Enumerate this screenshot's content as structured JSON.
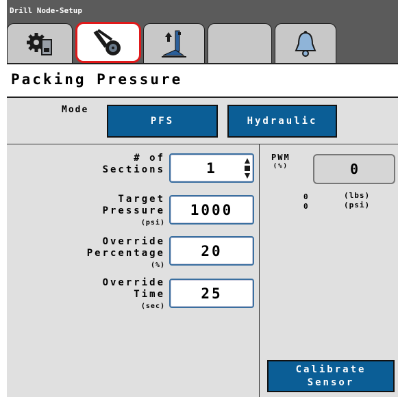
{
  "window": {
    "title": "Drill Node-Setup"
  },
  "tabs": [
    {
      "name": "settings-gear-tab",
      "icon": "gear-icon"
    },
    {
      "name": "packing-wheel-tab",
      "icon": "packing-wheel-icon",
      "active": true
    },
    {
      "name": "lift-tab",
      "icon": "lift-arrow-icon"
    },
    {
      "name": "empty-tab",
      "icon": ""
    },
    {
      "name": "alarm-tab",
      "icon": "bell-icon"
    }
  ],
  "page": {
    "title": "Packing Pressure"
  },
  "mode": {
    "label": "Mode",
    "options": [
      "PFS",
      "Hydraulic"
    ]
  },
  "fields": {
    "sections": {
      "label_line1": "# of",
      "label_line2": "Sections",
      "value": "1"
    },
    "target_pressure": {
      "label_line1": "Target",
      "label_line2": "Pressure",
      "unit": "(psi)",
      "value": "1000"
    },
    "override_percentage": {
      "label_line1": "Override",
      "label_line2": "Percentage",
      "unit": "(%)",
      "value": "20"
    },
    "override_time": {
      "label_line1": "Override",
      "label_line2": "Time",
      "unit": "(sec)",
      "value": "25"
    }
  },
  "readout": {
    "pwm_label": "PWM",
    "pwm_unit": "(%)",
    "pwm_value": "0",
    "lbs_value": "0",
    "lbs_unit": "(lbs)",
    "psi_value": "0",
    "psi_unit": "(psi)"
  },
  "buttons": {
    "calibrate_line1": "Calibrate",
    "calibrate_line2": "Sensor"
  },
  "colors": {
    "accent_blue": "#0b5e96",
    "active_tab_border": "#e0191a",
    "bar_gray": "#5b5b5b",
    "panel_gray": "#e0e0e0"
  }
}
